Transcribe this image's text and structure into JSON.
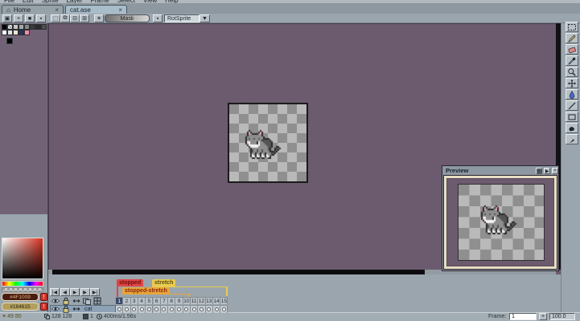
{
  "menu": {
    "items": [
      "File",
      "Edit",
      "Sprite",
      "Layer",
      "Frame",
      "Select",
      "View",
      "Help"
    ]
  },
  "tabs": {
    "home": {
      "label": "Home",
      "close": "×"
    },
    "document": {
      "label": "cat.ase",
      "close": "×"
    }
  },
  "context_bar": {
    "left_buttons": [
      "lock-icon",
      "add-icon",
      "square-icon",
      "small-square-icon"
    ],
    "selection_buttons": [
      "replace-selection-icon",
      "add-selection-icon",
      "subtract-selection-icon",
      "intersect-selection-icon"
    ],
    "mask_label": "Mask",
    "rotation_algorithm": "RotSprite"
  },
  "palette": {
    "row1": [
      "#000000",
      "checker",
      "#c6c6c6",
      "#a6a6a6",
      "#868686",
      "#3a3a3a",
      "#2a2a2a",
      "#4e4e4e"
    ],
    "row2": [
      "#ffffff",
      "#e2e2e2",
      "#f0e4cc",
      "#2c3450",
      "#f08cac"
    ],
    "foreground": "#000000"
  },
  "color_picker": {
    "fg_hex": "#4F1009",
    "bg_hex": "#164615",
    "fg_field_bg": "#4a1c10",
    "fg_field_text": "#e0b080",
    "bg_field_bg": "#b3a05e",
    "bg_field_text": "#2e2a10",
    "warning": "!"
  },
  "tools": [
    "rect-marquee",
    "pencil",
    "eraser",
    "eyedropper",
    "zoom",
    "move",
    "paint-bucket",
    "line",
    "rectangle",
    "contour",
    "jumble"
  ],
  "preview": {
    "title": "Preview",
    "buttons": [
      "grid",
      "play",
      "close"
    ]
  },
  "timeline": {
    "tags": [
      {
        "label": "stopped",
        "bg": "#e04545",
        "text": "#6e0e0e"
      },
      {
        "label": "stretch",
        "bg": "#e8cc50",
        "text": "#5c4c10"
      },
      {
        "label": "stopped-stretch",
        "bg": "#e8a53a",
        "text": "#8a2810"
      }
    ],
    "playback": [
      "|◀",
      "◀",
      "▶",
      "▶",
      "▶|"
    ],
    "frame_count": 15,
    "current_frame": 1,
    "layer_name": "cat"
  },
  "status_bar": {
    "position": "49 80",
    "sprite_size": "128 128",
    "frame_number": "1",
    "frame_time": "400ms/1.56s",
    "frame_label": "Frame:",
    "frame_field": "1",
    "add_button": "+",
    "zoom_value": "100.0"
  },
  "sprite": {
    "palette": {
      "K": "#2b2b2b",
      "G": "#8e8e8e",
      "D": "#555555",
      "W": "#f1f1f1",
      "P": "#e8a0b4"
    },
    "map": [
      "..K......K..............",
      ".KPK....KPK.............",
      ".KPGKKKKGPK.............",
      ".KGGGGGGGGK.............",
      "KGGGGGGGGGGK............",
      "KGDGGDGGDGGKKKK.........",
      "KGGGGGGGGGKDDDDK........",
      "KWWGGGGKWGGDDDDDK.......",
      "KPWGGGGKWGGGDDDDK.......",
      ".KWWWWWWWGGGGDDDK.......",
      "..KWWWWWGGGGGGDDK..KK...",
      "...KGGGGGGGGGGDK..KDDK..",
      "...KDGGDGGDGGGDK..KDK...",
      "...KDGGDGGDGGGGKKKDK....",
      "...KGGKGGKGGKGGGDDK.....",
      "...KWGKWGKWGKWGGKK......",
      "...KWWKWWKWWKWWK........",
      "....KK.KK.KK..KK........"
    ]
  }
}
